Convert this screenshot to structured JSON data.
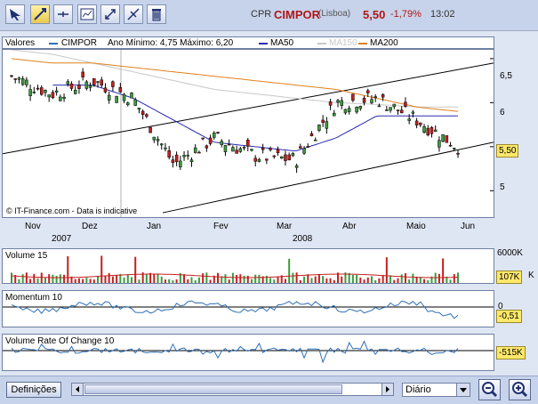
{
  "toolbar": {
    "tools": [
      "pointer-tool",
      "crosshair-tool",
      "line-tool",
      "indicators-tool",
      "zoom-fit-tool",
      "trend-line-tool",
      "delete-tool"
    ]
  },
  "header": {
    "ticker": "CPR",
    "name": "CIMPOR",
    "market": "(Lisboa)",
    "price": "5,50",
    "change": "-1,79%",
    "time": "13:02"
  },
  "legend": {
    "valores": "Valores",
    "series": "CIMPOR",
    "minmax": "Ano Mínimo: 4,75 Máximo: 6,20",
    "ma50": "MA50",
    "ma150": "MA150",
    "ma200": "MA200"
  },
  "credit": "© IT-Finance.com - Data is indicative",
  "price_axis": [
    "6,5",
    "6",
    "5,5",
    "5"
  ],
  "last_price": "5,50",
  "x_months": [
    "Nov",
    "Dez",
    "Jan",
    "Fev",
    "Mar",
    "Abr",
    "Maio",
    "Jun"
  ],
  "x_years": [
    "2007",
    "2008"
  ],
  "volume": {
    "label": "Volume 15",
    "axis_top": "6000K",
    "value": "107K",
    "axis_right": "K"
  },
  "momentum": {
    "label": "Momentum 10",
    "axis_zero": "0",
    "value": "-0,51"
  },
  "vroc": {
    "label": "Volume Rate Of Change 10",
    "value": "-515K"
  },
  "bottom": {
    "settings": "Definições",
    "period": "Diário"
  },
  "colors": {
    "up": "#3d9b3d",
    "down": "#c42020",
    "ma50": "#2a2ab0",
    "ma150": "#c8c8c8",
    "ma200": "#e0801e",
    "momentum": "#2f6fb5"
  },
  "chart_data": [
    {
      "type": "candlestick",
      "title": "CIMPOR",
      "ylim": [
        4.7,
        6.6
      ],
      "x": [
        "2007-10-26",
        "2007-11-16",
        "2007-12-07",
        "2007-12-28",
        "2008-01-18",
        "2008-02-08",
        "2008-02-29",
        "2008-03-21",
        "2008-04-11",
        "2008-05-02",
        "2008-05-16",
        "2008-05-23"
      ],
      "series": [
        {
          "name": "CIMPOR",
          "values": [
            6.3,
            6.1,
            6.25,
            6.05,
            5.3,
            5.6,
            5.4,
            5.35,
            6.0,
            6.05,
            5.8,
            5.5
          ]
        },
        {
          "name": "MA50",
          "values": [
            null,
            null,
            6.2,
            6.05,
            5.8,
            5.55,
            5.5,
            5.45,
            5.6,
            5.85,
            5.85,
            5.85
          ]
        },
        {
          "name": "MA150",
          "values": [
            6.6,
            6.55,
            6.45,
            6.35,
            6.25,
            6.15,
            6.1,
            6.05,
            6.0,
            5.98,
            5.95,
            5.95
          ]
        },
        {
          "name": "MA200",
          "values": [
            6.5,
            6.45,
            6.45,
            6.4,
            6.35,
            6.3,
            6.25,
            6.2,
            6.15,
            6.05,
            5.95,
            5.9
          ]
        }
      ],
      "grid": false
    },
    {
      "type": "bar",
      "title": "Volume 15",
      "ylim": [
        0,
        6000
      ],
      "last_value": 107
    },
    {
      "type": "line",
      "title": "Momentum 10",
      "last_value": -0.51
    },
    {
      "type": "line",
      "title": "Volume Rate Of Change 10",
      "last_value": -515
    }
  ]
}
